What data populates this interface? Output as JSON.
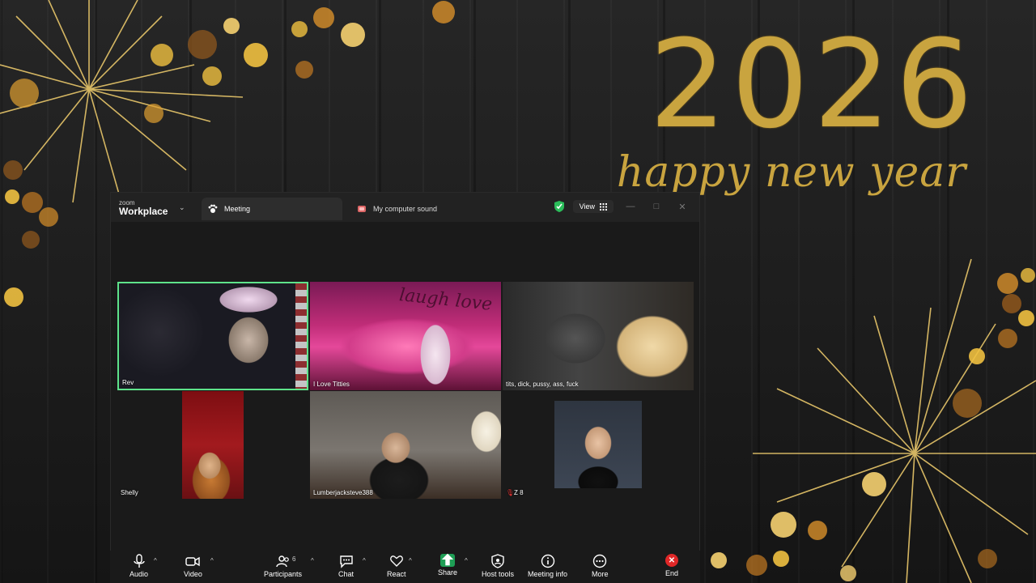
{
  "background": {
    "headline": "2026",
    "subline": "happy new year",
    "accent_color": "#c9a43f"
  },
  "titlebar": {
    "brand_small": "zoom",
    "brand_big": "Workplace",
    "tabs": [
      {
        "label": "Meeting",
        "icon": "paw-icon",
        "active": true
      },
      {
        "label": "My computer sound",
        "icon": "speaker-icon",
        "active": false
      }
    ],
    "view_label": "View",
    "security_icon": "shield-check-icon",
    "security_color": "#2bbd5a"
  },
  "participants": [
    {
      "name": "Rev",
      "speaking": true
    },
    {
      "name": "I Love Titties"
    },
    {
      "name": "tits, dick, pussy, ass, fuck"
    },
    {
      "name": "Shelly"
    },
    {
      "name": "Lumberjacksteve388"
    },
    {
      "name": "Z 8",
      "muted": true
    }
  ],
  "overlay_text": {
    "titties_script": "laugh love"
  },
  "toolbar": {
    "audio": "Audio",
    "video": "Video",
    "participants": "Participants",
    "participants_count": "6",
    "chat": "Chat",
    "react": "React",
    "share": "Share",
    "share_color": "#1e9e55",
    "host_tools": "Host tools",
    "meeting_info": "Meeting info",
    "more": "More",
    "end": "End",
    "end_color": "#e02727"
  }
}
